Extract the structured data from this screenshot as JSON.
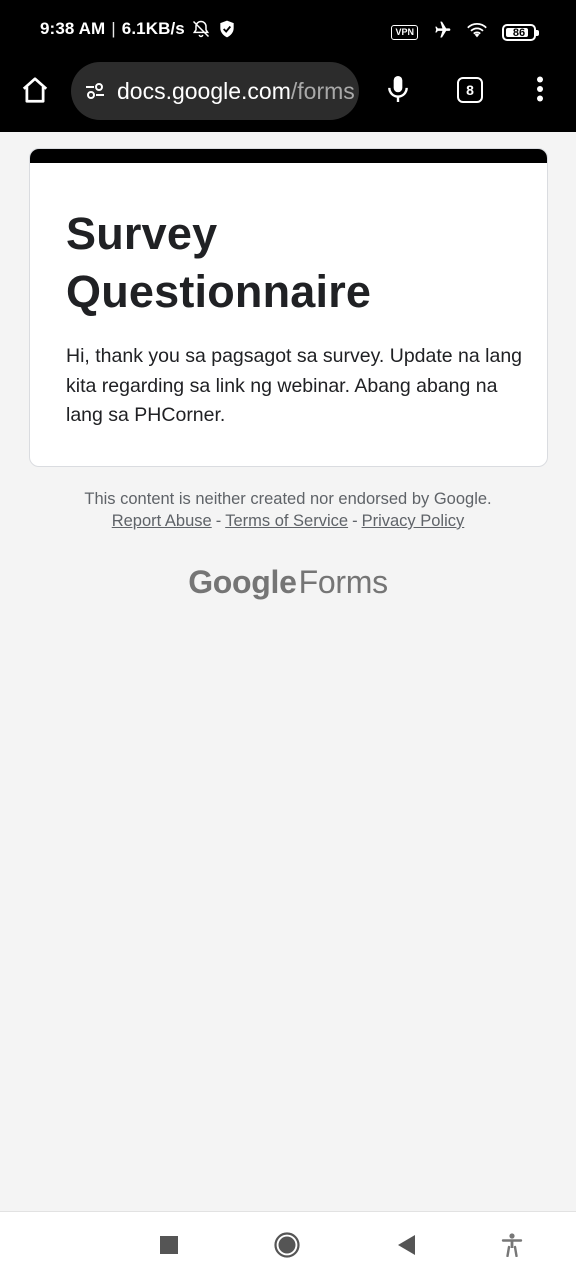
{
  "status_bar": {
    "time": "9:38 AM",
    "separator": "|",
    "network_speed": "6.1KB/s",
    "vpn_label": "VPN",
    "battery_level": "86",
    "icons": [
      "bell-off-icon",
      "shield-icon",
      "airplane-icon",
      "wifi-icon",
      "battery-icon"
    ]
  },
  "browser": {
    "url_domain": "docs.google.com",
    "url_path": "/forms",
    "tab_count": "8",
    "icons": [
      "home-icon",
      "tune-icon",
      "mic-icon",
      "more-vert-icon"
    ],
    "dark_color": "#000000",
    "url_bar_color": "#2c2c2c"
  },
  "form": {
    "title": "Survey Questionnaire",
    "description": "Hi, thank you sa pagsagot sa survey. Update na lang kita regarding sa link ng webinar. Abang abang na lang sa PHCorner.",
    "accent_color": "#000000"
  },
  "footer": {
    "disclaimer": "This content is neither created nor endorsed by Google.",
    "separator": "-",
    "links": {
      "report_abuse": "Report Abuse",
      "terms": "Terms of Service",
      "privacy": "Privacy Policy"
    },
    "logo_google": "Google",
    "logo_forms": "Forms"
  },
  "nav_bar": {
    "icons": [
      "recents-icon",
      "home-circle-icon",
      "back-icon",
      "accessibility-icon"
    ]
  }
}
